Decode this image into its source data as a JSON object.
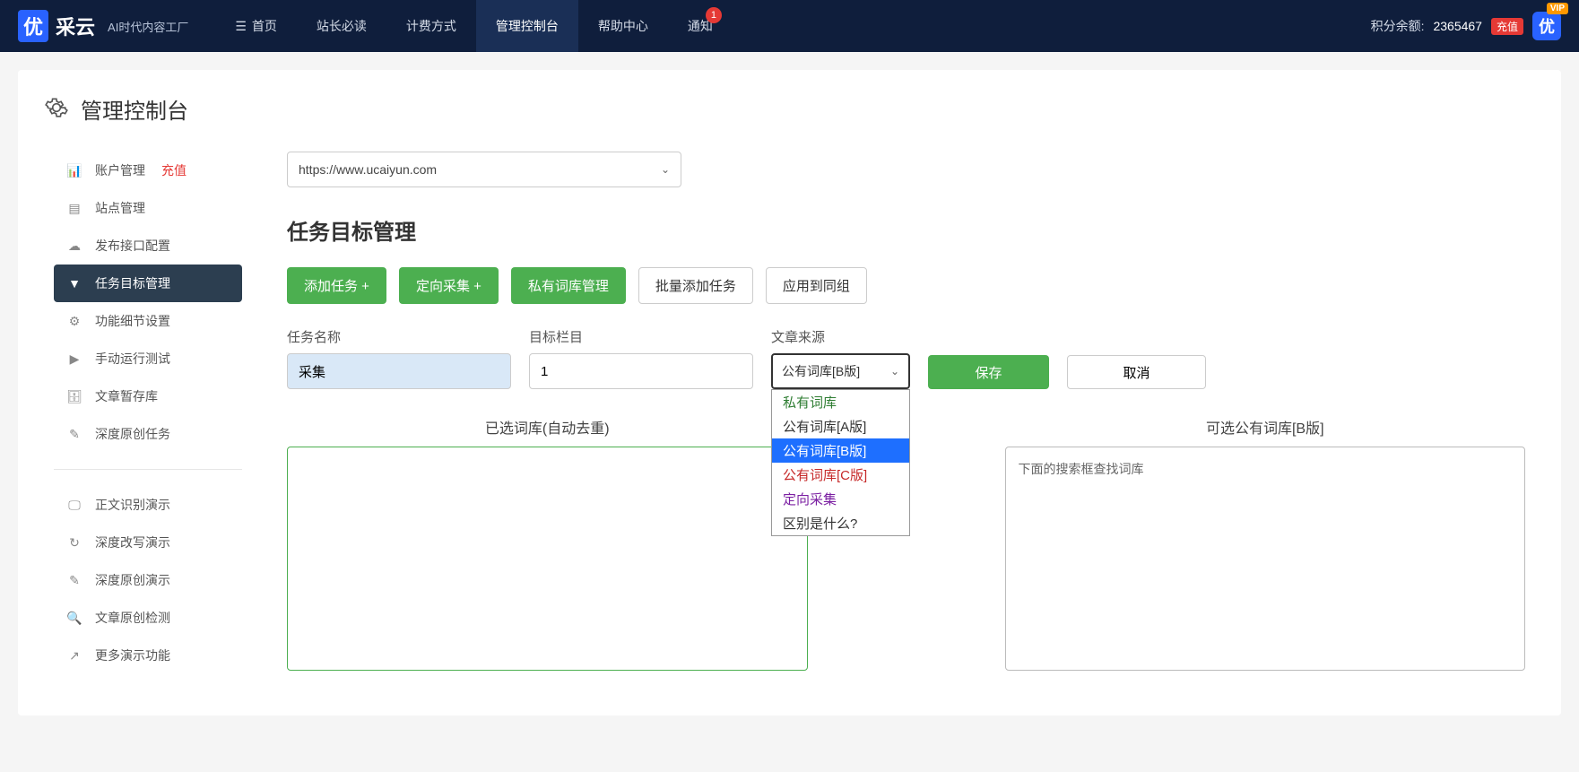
{
  "topnav": {
    "logo_main": "优",
    "logo_text": "采云",
    "logo_sub": "AI时代内容工厂",
    "items": [
      "首页",
      "站长必读",
      "计费方式",
      "管理控制台",
      "帮助中心",
      "通知"
    ],
    "notify_badge": "1",
    "points_label": "积分余额:",
    "points_value": "2365467",
    "recharge": "充值",
    "vip": "VIP",
    "avatar": "优"
  },
  "page": {
    "title": "管理控制台"
  },
  "sidebar": {
    "items": [
      {
        "label": "账户管理",
        "extra": "充值"
      },
      {
        "label": "站点管理"
      },
      {
        "label": "发布接口配置"
      },
      {
        "label": "任务目标管理"
      },
      {
        "label": "功能细节设置"
      },
      {
        "label": "手动运行测试"
      },
      {
        "label": "文章暂存库"
      },
      {
        "label": "深度原创任务"
      }
    ],
    "demo": [
      "正文识别演示",
      "深度改写演示",
      "深度原创演示",
      "文章原创检测",
      "更多演示功能"
    ]
  },
  "main": {
    "site_url": "https://www.ucaiyun.com",
    "section_title": "任务目标管理",
    "buttons": {
      "add_task": "添加任务 +",
      "direct_collect": "定向采集 +",
      "private_lib": "私有词库管理",
      "batch_add": "批量添加任务",
      "apply_group": "应用到同组"
    },
    "form": {
      "task_name_label": "任务名称",
      "task_name_value": "采集",
      "target_col_label": "目标栏目",
      "target_col_value": "1",
      "source_label": "文章来源",
      "source_value": "公有词库[B版]",
      "save": "保存",
      "cancel": "取消"
    },
    "dropdown": [
      "私有词库",
      "公有词库[A版]",
      "公有词库[B版]",
      "公有词库[C版]",
      "定向采集",
      "区别是什么?"
    ],
    "lib_left_title": "已选词库(自动去重)",
    "lib_right_title": "可选公有词库[B版]",
    "lib_right_hint": "下面的搜索框查找词库"
  }
}
